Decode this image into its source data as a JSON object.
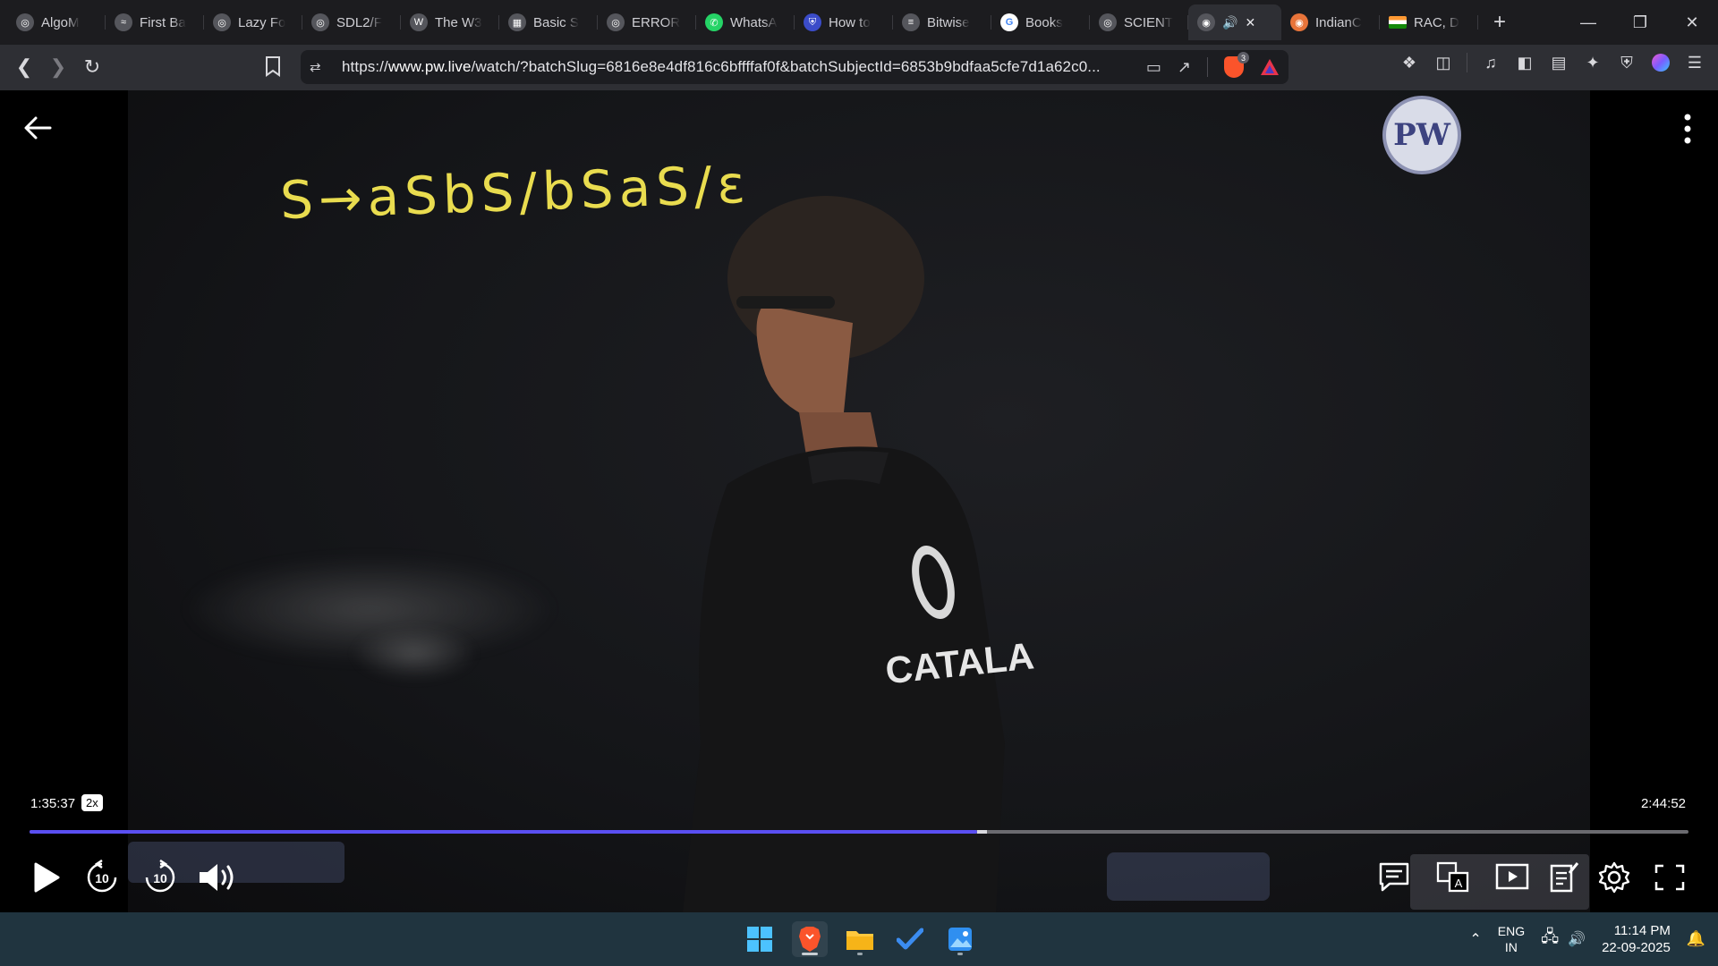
{
  "browser": {
    "tabs": [
      {
        "title": "AlgoM",
        "icon": "globe-icon"
      },
      {
        "title": "First Ba",
        "icon": "lightning-icon"
      },
      {
        "title": "Lazy Fo",
        "icon": "globe-icon"
      },
      {
        "title": "SDL2/F",
        "icon": "globe-icon"
      },
      {
        "title": "The W3",
        "icon": "wordpress-icon"
      },
      {
        "title": "Basic S",
        "icon": "ms-icon"
      },
      {
        "title": "ERROR",
        "icon": "globe-icon"
      },
      {
        "title": "WhatsA",
        "icon": "whatsapp-icon"
      },
      {
        "title": "How to",
        "icon": "shield-icon"
      },
      {
        "title": "Bitwise",
        "icon": "site-icon"
      },
      {
        "title": "Books",
        "icon": "google-icon"
      },
      {
        "title": "SCIENT",
        "icon": "globe-icon"
      },
      {
        "title": "",
        "icon": "pw-icon",
        "active": true
      },
      {
        "title": "IndianC",
        "icon": "bowl-icon"
      },
      {
        "title": "RAC, D",
        "icon": "india-flag-icon"
      }
    ],
    "new_tab": "+",
    "url_prefix": "https://",
    "url_host": "www.pw.live",
    "url_path": "/watch/?batchSlug=6816e8e4df816c6bffffaf0f&batchSubjectId=6853b9bdfaa5cfe7d1a62c0...",
    "brave_shield_count": "3"
  },
  "player": {
    "board_text": "S→aSbS/bSaS/ε",
    "shirt_text": "CATALA",
    "logo_text": "PW",
    "current_time": "1:35:37",
    "speed": "2x",
    "total_time": "2:44:52",
    "progress_fraction": 0.571,
    "buffered_fraction": 0.577,
    "rewind_label": "10",
    "forward_label": "10"
  },
  "taskbar": {
    "lang_top": "ENG",
    "lang_bottom": "IN",
    "time": "11:14 PM",
    "date": "22-09-2025"
  },
  "colors": {
    "accent": "#5a4ff2",
    "chalk": "#e9dc4f",
    "taskbar": "#20343f"
  }
}
